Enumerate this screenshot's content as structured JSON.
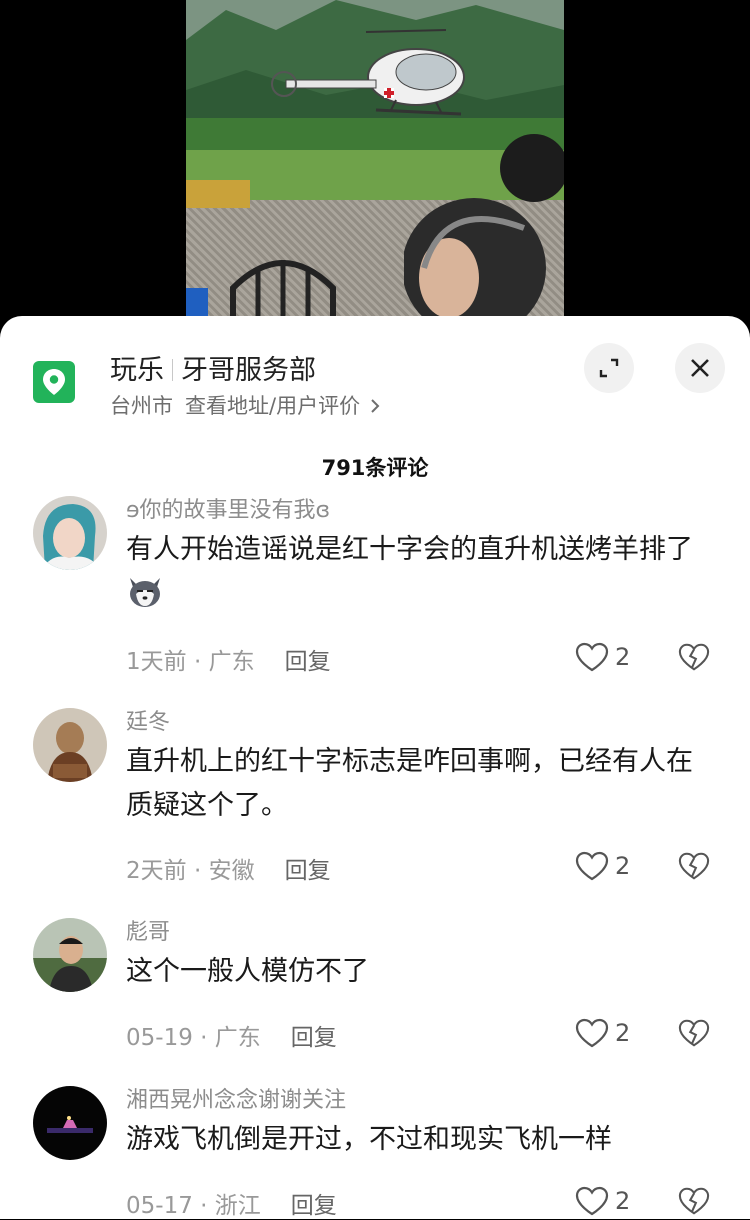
{
  "location": {
    "category": "玩乐",
    "name": "牙哥服务部",
    "city": "台州市",
    "link": "查看地址/用户评价",
    "icon": "location-pin-icon",
    "accent_color": "#22b35a"
  },
  "comments_header": {
    "count_label": "791条评论"
  },
  "comments": [
    {
      "user": "ɘ你的故事里没有我ɞ",
      "text": "有人开始造谣说是红十字会的直升机送烤羊排了",
      "time": "1天前",
      "region": "广东",
      "reply": "回复",
      "likes": "2",
      "emoji": "husky-face-emoji"
    },
    {
      "user": "廷冬",
      "text": "直升机上的红十字标志是咋回事啊，已经有人在质疑这个了。",
      "time": "2天前",
      "region": "安徽",
      "reply": "回复",
      "likes": "2"
    },
    {
      "user": "彪哥",
      "text": "这个一般人模仿不了",
      "time": "05-19",
      "region": "广东",
      "reply": "回复",
      "likes": "2"
    },
    {
      "user": "湘西晃州念念谢谢关注",
      "text": "游戏飞机倒是开过，不过和现实飞机一样",
      "time": "05-17",
      "region": "浙江",
      "reply": "回复",
      "likes": "2"
    }
  ]
}
